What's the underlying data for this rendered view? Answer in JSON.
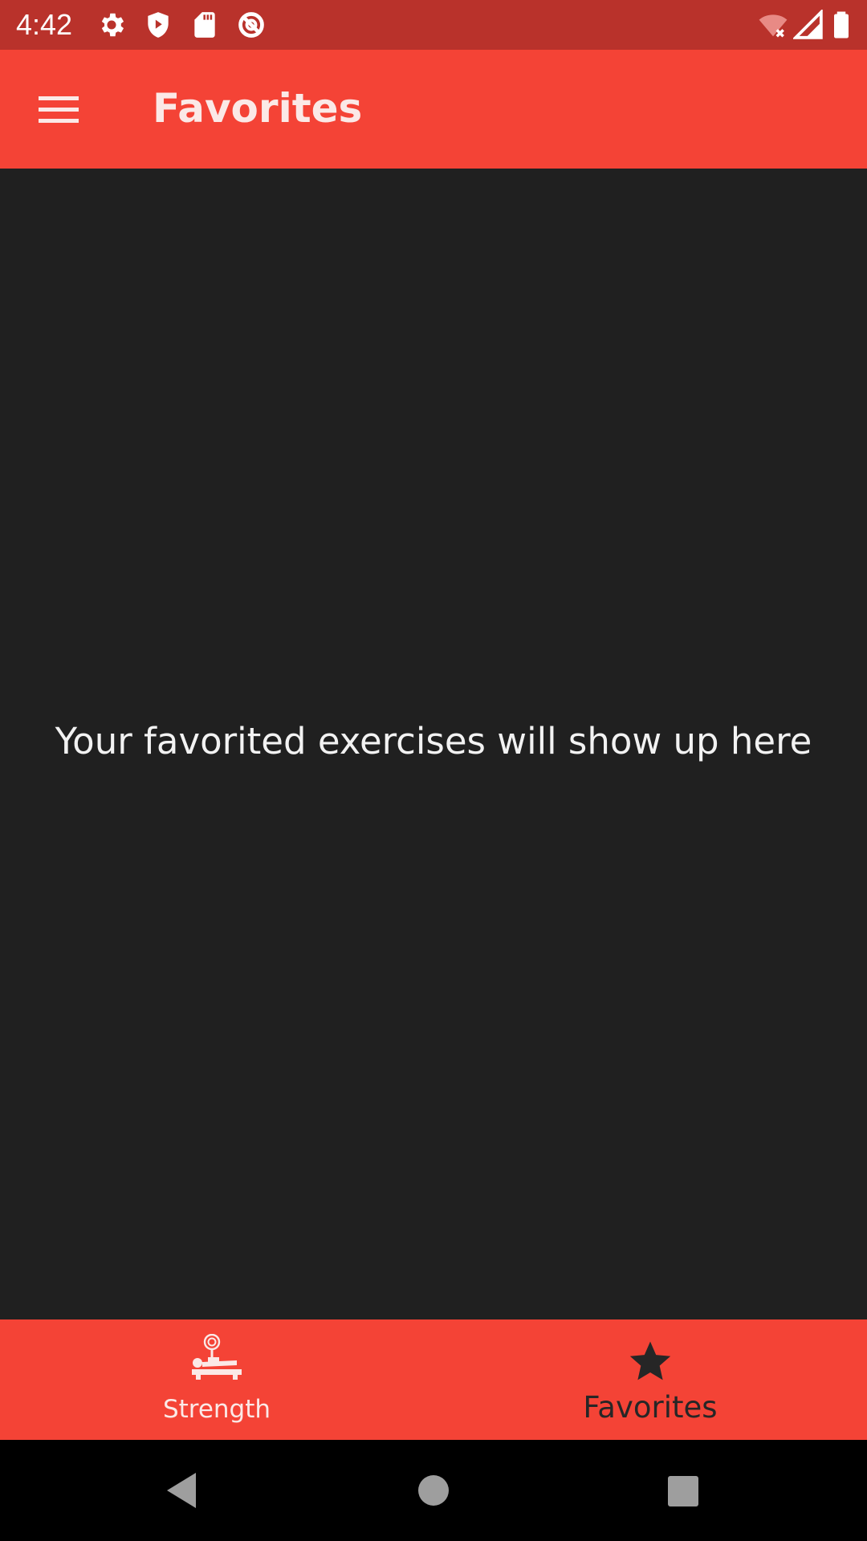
{
  "status_bar": {
    "time": "4:42",
    "icons": [
      "settings-icon",
      "shield-icon",
      "sd-card-icon",
      "data-saver-icon",
      "wifi-off-icon",
      "signal-icon",
      "battery-icon"
    ]
  },
  "app_bar": {
    "title": "Favorites",
    "menu_icon": "hamburger-menu-icon"
  },
  "content": {
    "empty_message": "Your favorited exercises will show up here"
  },
  "bottom_nav": {
    "items": [
      {
        "label": "Strength",
        "icon": "bench-press-icon",
        "selected": false
      },
      {
        "label": "Favorites",
        "icon": "star-icon",
        "selected": true
      }
    ]
  },
  "system_nav": {
    "buttons": [
      "back-icon",
      "home-icon",
      "recents-icon"
    ]
  },
  "colors": {
    "status_bar": "#b9322b",
    "app_bar": "#f44336",
    "background": "#202020",
    "bottom_nav": "#f44336",
    "system_nav": "#000000",
    "selected_nav": "#262626",
    "unselected_nav": "#fbe9e7"
  }
}
